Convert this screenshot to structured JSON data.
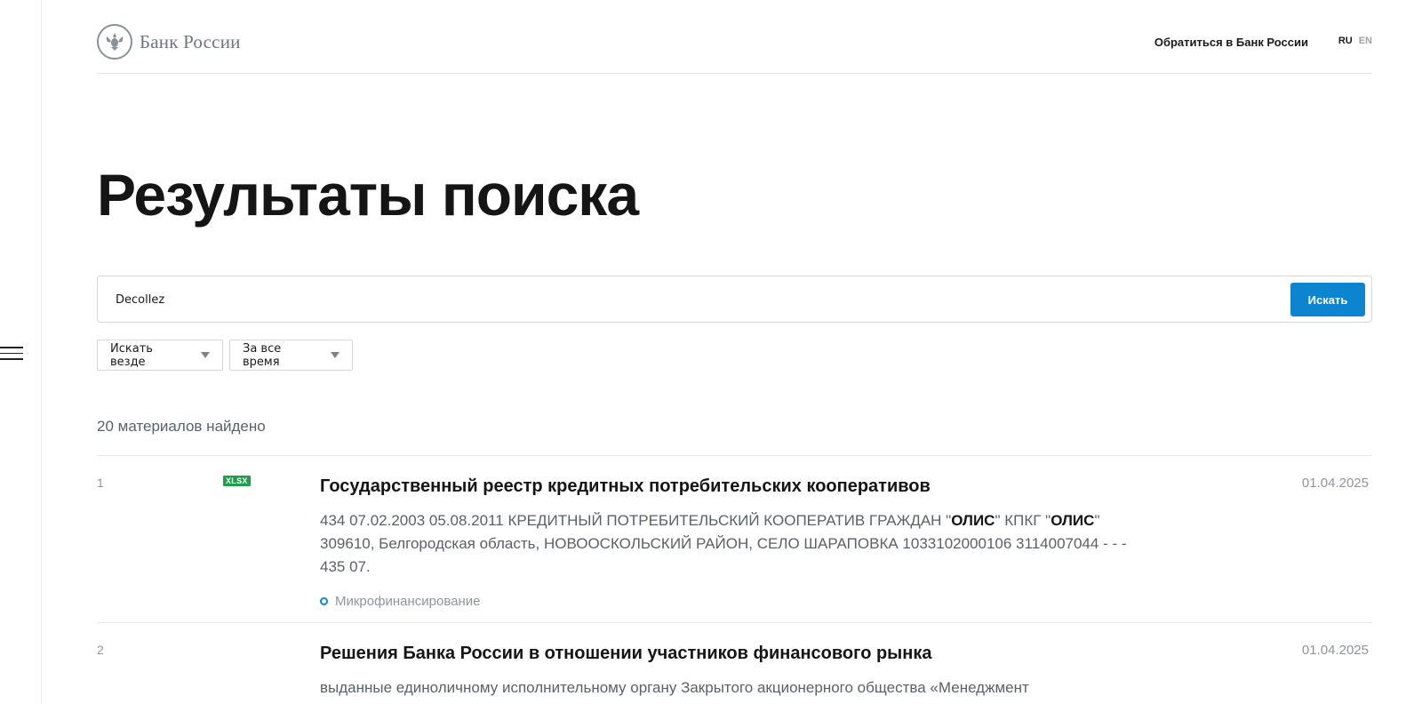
{
  "header": {
    "logo_text": "Банк России",
    "contact_link": "Обратиться в Банк России",
    "lang_ru": "RU",
    "lang_en": "EN"
  },
  "page": {
    "title": "Результаты поиска"
  },
  "search": {
    "query": "Decollez",
    "button_label": "Искать"
  },
  "filters": {
    "where": "Искать везде",
    "time": "За все время"
  },
  "results_count": "20 материалов найдено",
  "results": [
    {
      "number": "1",
      "badge": "XLSX",
      "title": "Государственный реестр кредитных потребительских кооперативов",
      "date": "01.04.2025",
      "snippet_parts": [
        "434 07.02.2003 05.08.2011 КРЕДИТНЫЙ ПОТРЕБИТЕЛЬСКИЙ КООПЕРАТИВ ГРАЖДАН \"",
        "ОЛИС",
        "\" КПКГ \"",
        "ОЛИС",
        "\" 309610, Белгородская область, НОВООСКОЛЬСКИЙ РАЙОН, СЕЛО ШАРАПОВКА 1033102000106 3114007044 - - - 435 07."
      ],
      "tag": "Микрофинансирование"
    },
    {
      "number": "2",
      "title": "Решения Банка России в отношении участников финансового рынка",
      "date": "01.04.2025",
      "snippet": "выданные единоличному исполнительному органу Закрытого акционерного общества «Менеджмент"
    }
  ],
  "colors": {
    "accent": "#0d84d0",
    "badge_green": "#1e9f4c",
    "muted_text": "#8f959c"
  },
  "icons": {
    "menu": "hamburger-icon",
    "logo": "bank-emblem-icon",
    "dropdown": "caret-down-icon",
    "tag_dot": "circle-dot-icon"
  }
}
